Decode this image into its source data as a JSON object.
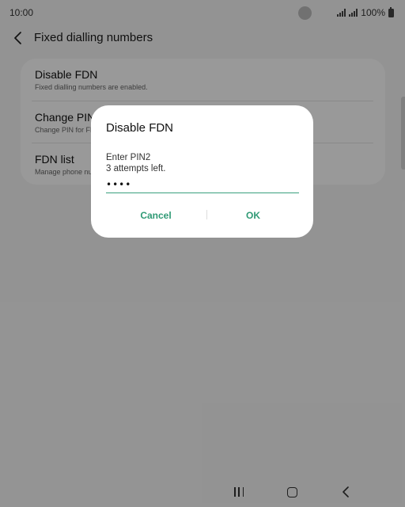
{
  "status_bar": {
    "time": "10:00",
    "battery_label": "100%"
  },
  "app_bar": {
    "title": "Fixed dialling numbers"
  },
  "settings": {
    "items": [
      {
        "title": "Disable FDN",
        "subtitle": "Fixed dialling numbers are enabled."
      },
      {
        "title": "Change PIN2",
        "subtitle": "Change PIN for FDN"
      },
      {
        "title": "FDN list",
        "subtitle": "Manage phone numbers"
      }
    ]
  },
  "dialog": {
    "title": "Disable FDN",
    "label": "Enter PIN2",
    "hint": "3 attempts left.",
    "pin_value": "••••",
    "cancel_label": "Cancel",
    "ok_label": "OK"
  },
  "colors": {
    "accent": "#2f9a75",
    "scrim": "rgba(0,0,0,0.40)"
  },
  "icons": {
    "back": "chevron-left-icon",
    "signal": "signal-icon",
    "battery": "battery-icon",
    "recents": "recents-icon",
    "home": "home-icon",
    "nav_back": "nav-back-icon"
  }
}
